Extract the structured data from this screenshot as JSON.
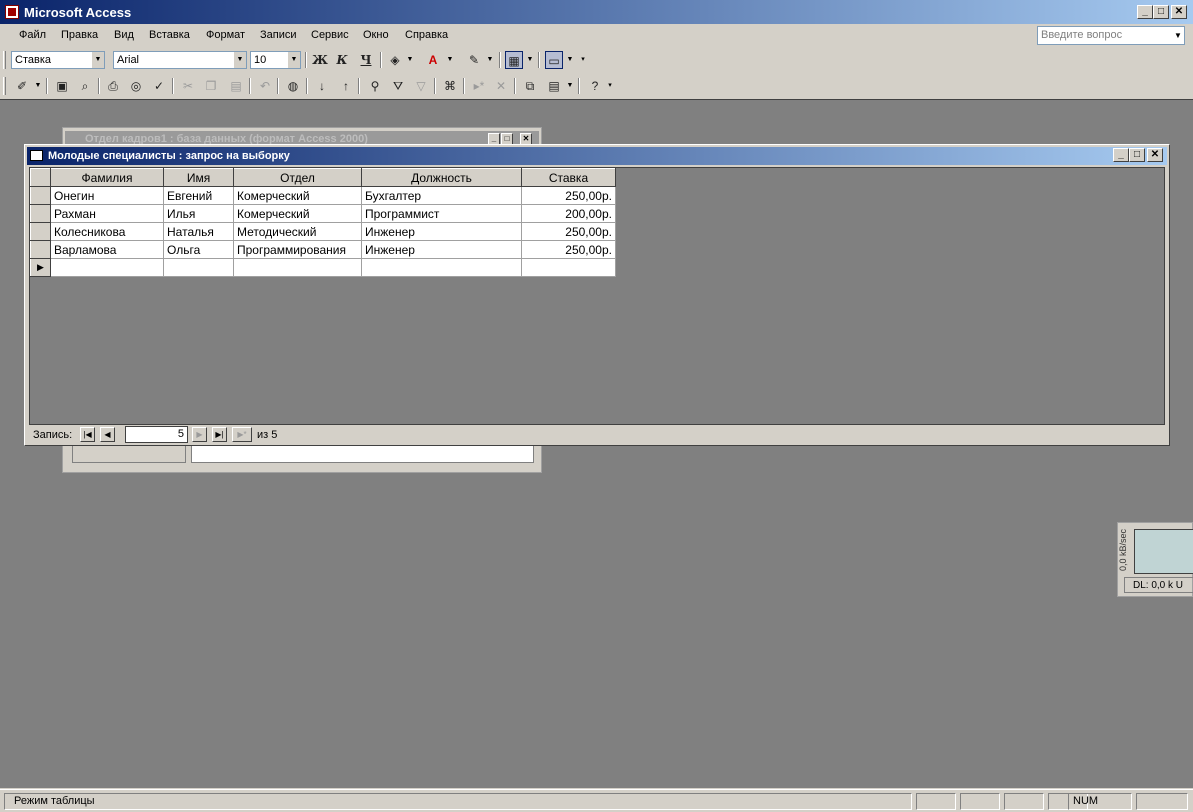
{
  "app": {
    "title": "Microsoft Access"
  },
  "menu": [
    "Файл",
    "Правка",
    "Вид",
    "Вставка",
    "Формат",
    "Записи",
    "Сервис",
    "Окно",
    "Справка"
  ],
  "ask_placeholder": "Введите вопрос",
  "format_toolbar": {
    "field_combo": "Ставка",
    "font_combo": "Arial",
    "size_combo": "10",
    "bold": "Ж",
    "italic": "К",
    "underline": "Ч"
  },
  "back_window": {
    "title": "Отдел кадров1 : база данных (формат Access 2000)"
  },
  "query_window": {
    "title": "Молодые специалисты : запрос на выборку",
    "columns": [
      "Фамилия",
      "Имя",
      "Отдел",
      "Должность",
      "Ставка"
    ],
    "rows": [
      [
        "Онегин",
        "Евгений",
        "Комерческий",
        "Бухгалтер",
        "250,00р."
      ],
      [
        "Рахман",
        "Илья",
        "Комерческий",
        "Программист",
        "200,00р."
      ],
      [
        "Колесникова",
        "Наталья",
        "Методический",
        "Инженер",
        "250,00р."
      ],
      [
        "Варламова",
        "Ольга",
        "Программирования",
        "Инженер",
        "250,00р."
      ]
    ],
    "nav": {
      "label": "Запись:",
      "current": "5",
      "total_label": "из 5"
    }
  },
  "net_meter": {
    "vertical_label": "0,0 kB/sec",
    "dl": "DL: 0,0 k  U"
  },
  "status": {
    "text": "Режим таблицы",
    "num": "NUM"
  },
  "colors": {
    "title_start": "#0a246a",
    "title_end": "#a6caf0",
    "workspace": "#808080",
    "chrome": "#d4d0c8"
  }
}
